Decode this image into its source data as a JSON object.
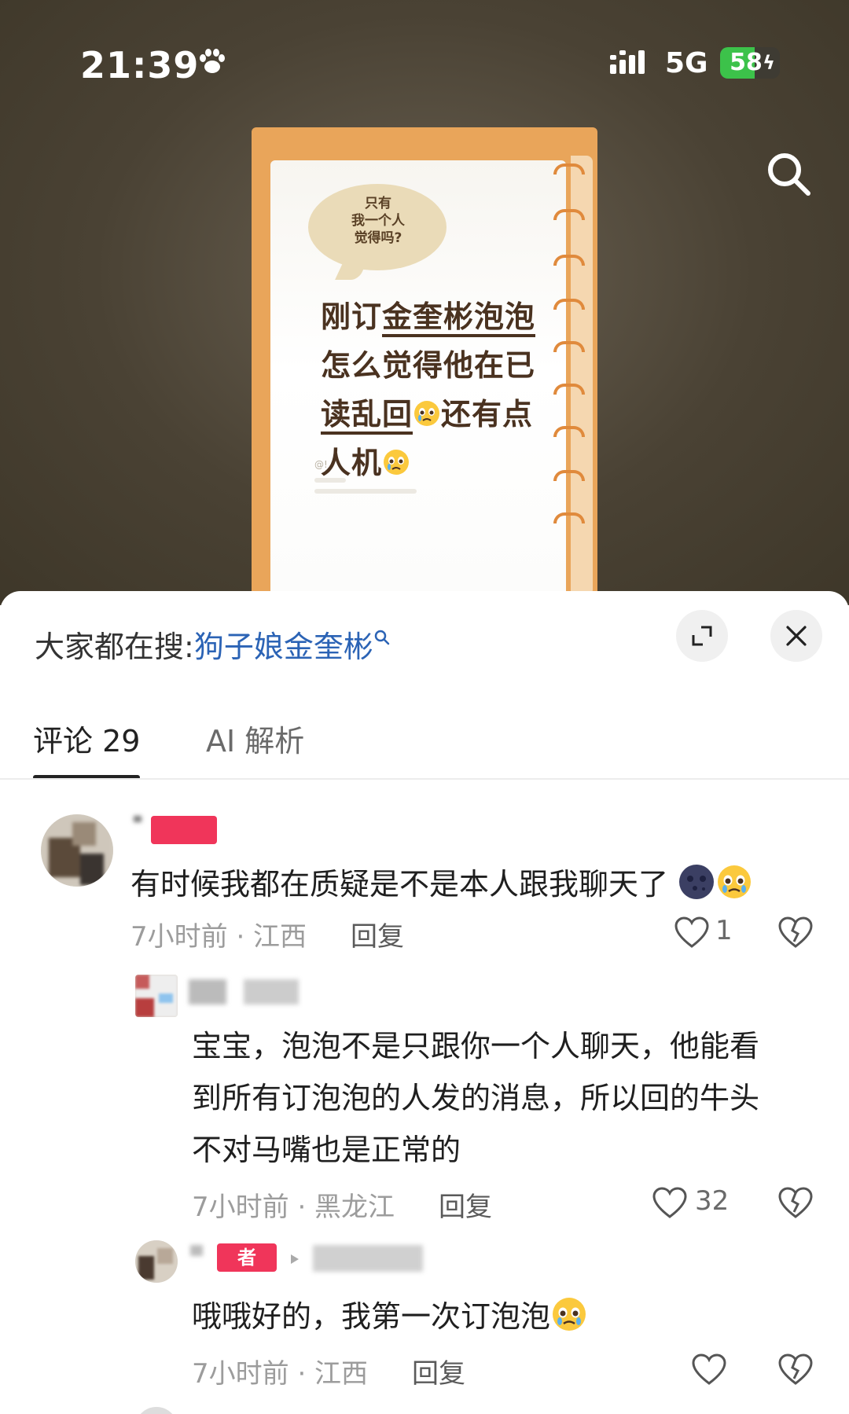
{
  "status_bar": {
    "time": "21:39",
    "network": "5G",
    "battery_level": "58",
    "battery_percent": 58,
    "battery_color": "#3cc24a",
    "icons": [
      "paw-icon",
      "signal-icon",
      "charging-bolt-icon"
    ]
  },
  "post_image": {
    "bubble_lines": [
      "只有",
      "我一个人",
      "觉得吗?"
    ],
    "headline_line1_prefix": "刚订",
    "headline_line1_underlined": "金奎彬泡泡",
    "headline_line2": "怎么觉得他在已",
    "headline_line3_underlined": "读乱回",
    "headline_line3_suffix": "还有点",
    "headline_line4": "人机",
    "footer_handle": "@!",
    "accent_color": "#e9a55a"
  },
  "sheet": {
    "trending_prefix": "大家都在搜:",
    "trending_query": "狗子娘金奎彬",
    "expand_button": "expand-icon",
    "close_button": "close-icon"
  },
  "tabs": [
    {
      "label": "评论 29",
      "active": true
    },
    {
      "label": "AI 解析",
      "active": false
    }
  ],
  "comments": [
    {
      "badge": "",
      "text": "有时候我都在质疑是不是本人跟我聊天了",
      "emojis": [
        "moon-face-emoji",
        "pleading-cry-emoji"
      ],
      "meta": "7小时前 · 江西",
      "reply_label": "回复",
      "likes": "1"
    },
    {
      "badge": "",
      "text_lines": [
        "宝宝，泡泡不是只跟你一个人聊天，他能看",
        "到所有订泡泡的人发的消息，所以回的牛头",
        "不对马嘴也是正常的"
      ],
      "meta": "7小时前 · 黑龙江",
      "reply_label": "回复",
      "likes": "32"
    },
    {
      "badge": "者",
      "text": "哦哦好的，我第一次订泡泡",
      "emojis": [
        "pleading-cry-emoji"
      ],
      "meta": "7小时前 · 江西",
      "reply_label": "回复",
      "likes": ""
    }
  ]
}
